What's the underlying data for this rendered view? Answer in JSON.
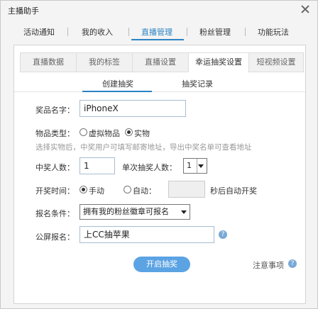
{
  "window": {
    "title": "主播助手"
  },
  "main_tabs": [
    {
      "label": "活动通知"
    },
    {
      "label": "我的收入"
    },
    {
      "label": "直播管理"
    },
    {
      "label": "粉丝管理"
    },
    {
      "label": "功能玩法"
    }
  ],
  "sub_tabs": [
    {
      "label": "直播数据"
    },
    {
      "label": "我的标签"
    },
    {
      "label": "直播设置"
    },
    {
      "label": "幸运抽奖设置"
    },
    {
      "label": "短视频设置"
    }
  ],
  "inner_tabs": [
    {
      "label": "创建抽奖"
    },
    {
      "label": "抽奖记录"
    }
  ],
  "form": {
    "prize_name_label": "奖品名字：",
    "prize_name_value": "iPhoneX",
    "item_type_label": "物品类型：",
    "item_type_virtual": "虚拟物品",
    "item_type_physical": "实物",
    "item_type_selected": "实物",
    "physical_hint": "选择实物后，中奖用户可填写邮寄地址，导出中奖名单可查看地址",
    "winners_label": "中奖人数：",
    "winners_value": "1",
    "per_draw_label": "单次抽奖人数：",
    "per_draw_value": "1",
    "draw_time_label": "开奖时间：",
    "draw_time_manual": "手动",
    "draw_time_auto": "自动：",
    "draw_time_selected": "手动",
    "auto_suffix": "秒后自动开奖",
    "signup_label": "报名条件：",
    "signup_value": "拥有我的粉丝徽章可报名",
    "public_label": "公屏报名：",
    "public_value": "上CC抽苹果",
    "start_button": "开启抽奖",
    "notes_link": "注意事项",
    "help_glyph": "?"
  }
}
